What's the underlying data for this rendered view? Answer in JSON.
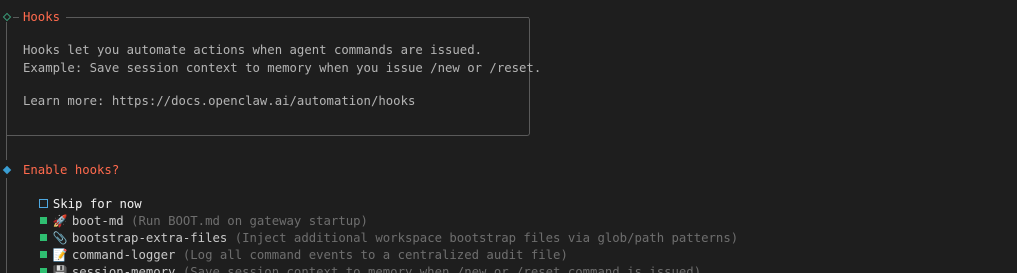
{
  "hooks_box": {
    "title": "Hooks",
    "line1": "Hooks let you automate actions when agent commands are issued.",
    "line2": "Example: Save session context to memory when you issue /new or /reset.",
    "learn_more": "Learn more: https://docs.openclaw.ai/automation/hooks"
  },
  "prompt": {
    "question": "Enable hooks?",
    "skip_label": "Skip for now",
    "options": [
      {
        "name": "boot-md",
        "desc": "(Run BOOT.md on gateway startup)",
        "icon": "rocket-icon",
        "glyph": "🚀"
      },
      {
        "name": "bootstrap-extra-files",
        "desc": "(Inject additional workspace bootstrap files via glob/path patterns)",
        "icon": "paperclip-icon",
        "glyph": "📎"
      },
      {
        "name": "command-logger",
        "desc": "(Log all command events to a centralized audit file)",
        "icon": "notepad-icon",
        "glyph": "📝"
      },
      {
        "name": "session-memory",
        "desc": "(Save session context to memory when /new or /reset command is issued)",
        "icon": "floppy-disk-icon",
        "glyph": "💾"
      }
    ]
  },
  "colors": {
    "title": "#ff6a4d",
    "selected_marker": "#2fbf71",
    "cursor_marker": "#4fa8e0",
    "border": "#5a5a5a",
    "background": "#1e1e1e"
  }
}
